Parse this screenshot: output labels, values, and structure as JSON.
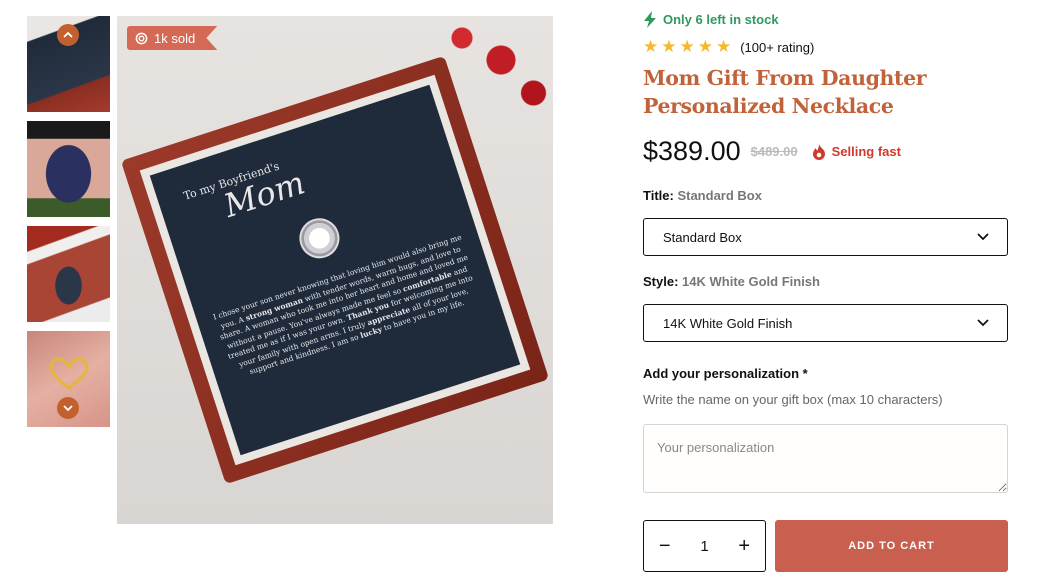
{
  "gallery": {
    "badge": "1k sold",
    "card_heading": "To my Boyfriend's",
    "card_name": "Mom",
    "card_message_parts": [
      {
        "text": "I chose your son never knowing that loving him would also bring me you. A ",
        "bold": false
      },
      {
        "text": "strong woman",
        "bold": true
      },
      {
        "text": " with tender words, warm hugs, and love to share. A woman who took me into her heart and home and loved me without a pause. You've always made me feel so ",
        "bold": false
      },
      {
        "text": "comfortable",
        "bold": true
      },
      {
        "text": " and treated me as if I was your own. ",
        "bold": false
      },
      {
        "text": "Thank you",
        "bold": true
      },
      {
        "text": " for welcoming me into your family with open arms. I truly ",
        "bold": false
      },
      {
        "text": "appreciate",
        "bold": true
      },
      {
        "text": " all of your love, support and kindness. I am so ",
        "bold": false
      },
      {
        "text": "lucky",
        "bold": true
      },
      {
        "text": " to have you in my life.",
        "bold": false
      }
    ]
  },
  "product": {
    "stock": "Only 6 left in stock",
    "rating_stars": 5,
    "rating_text": "(100+ rating)",
    "title_line1": "Mom Gift From Daughter",
    "title_line2": "Personalized Necklace",
    "price": "$389.00",
    "compare_price": "$489.00",
    "selling_fast": "Selling fast",
    "title_label": "Title:",
    "title_value": "Standard Box",
    "title_selected": "Standard Box",
    "style_label": "Style:",
    "style_value": "14K White Gold Finish",
    "style_selected": "14K White Gold Finish",
    "personalization_label": "Add your personalization *",
    "personalization_help": "Write the name on your gift box (max 10 characters)",
    "personalization_placeholder": "Your personalization",
    "quantity": "1",
    "add_to_cart": "ADD TO CART"
  },
  "colors": {
    "accent": "#c95f4e",
    "title": "#c0633a",
    "stock": "#2f9a5c",
    "star": "#f5b82e",
    "selling": "#d0392b"
  }
}
